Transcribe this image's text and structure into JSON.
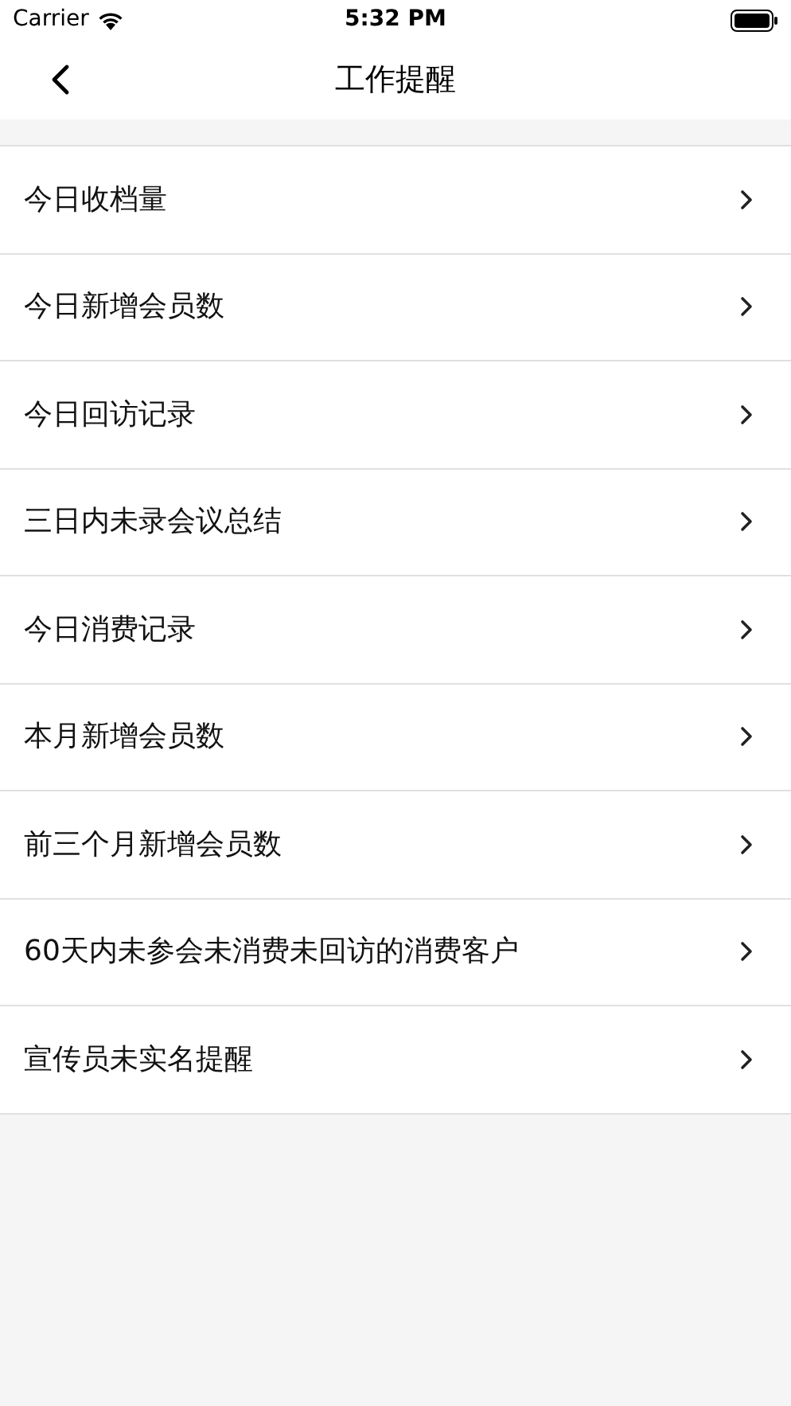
{
  "status_bar": {
    "carrier": "Carrier",
    "time": "5:32 PM"
  },
  "nav": {
    "title": "工作提醒"
  },
  "items": [
    {
      "label": "今日收档量"
    },
    {
      "label": "今日新增会员数"
    },
    {
      "label": "今日回访记录"
    },
    {
      "label": "三日内未录会议总结"
    },
    {
      "label": "今日消费记录"
    },
    {
      "label": "本月新增会员数"
    },
    {
      "label": "前三个月新增会员数"
    },
    {
      "label": "60天内未参会未消费未回访的消费客户"
    },
    {
      "label": "宣传员未实名提醒"
    }
  ]
}
